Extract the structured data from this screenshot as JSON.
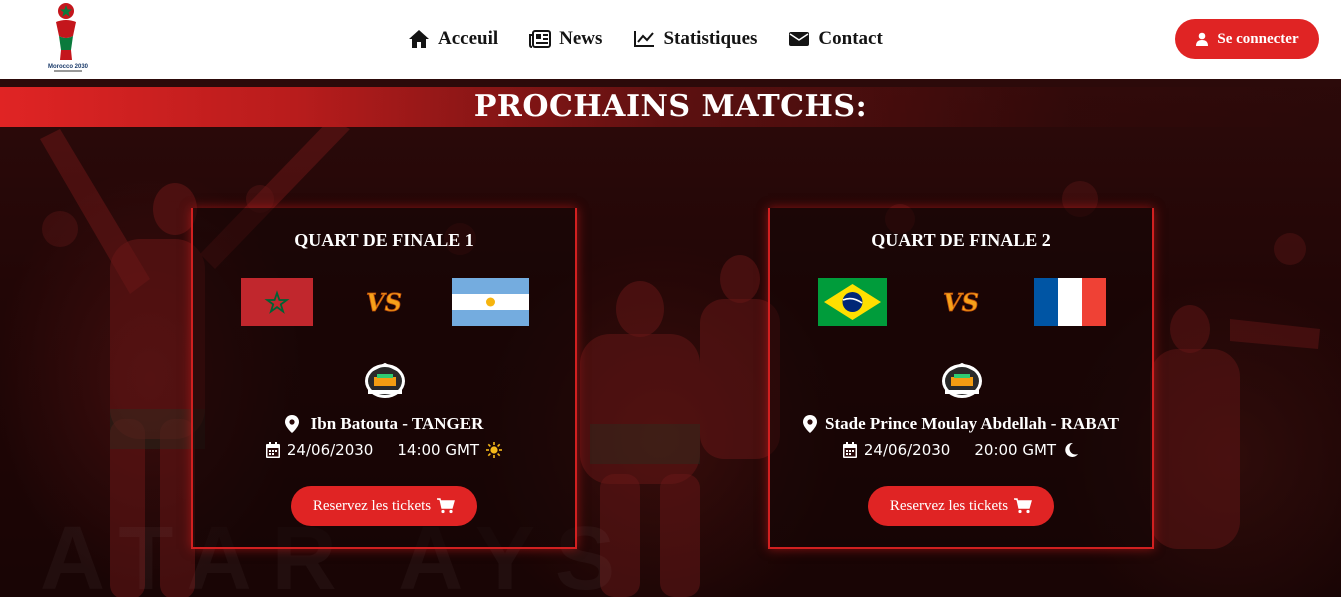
{
  "nav": {
    "items": [
      {
        "label": "Acceuil",
        "icon": "home-icon"
      },
      {
        "label": "News",
        "icon": "newspaper-icon"
      },
      {
        "label": "Statistiques",
        "icon": "chart-line-icon"
      },
      {
        "label": "Contact",
        "icon": "envelope-icon"
      }
    ],
    "login_label": "Se connecter"
  },
  "logo": {
    "text": "Morocco 2030"
  },
  "hero": {
    "title": "PROCHAINS MATCHS:"
  },
  "matches": [
    {
      "title": "QUART DE FINALE 1",
      "home_flag": "morocco-flag",
      "away_flag": "argentina-flag",
      "venue": "Ibn Batouta - TANGER",
      "date": "24/06/2030",
      "time": "14:00 GMT",
      "time_icon": "sun-icon",
      "ticket_label": "Reservez les tickets"
    },
    {
      "title": "QUART DE FINALE 2",
      "home_flag": "brazil-flag",
      "away_flag": "france-flag",
      "venue": "Stade Prince Moulay Abdellah - RABAT",
      "date": "24/06/2030",
      "time": "20:00 GMT",
      "time_icon": "moon-icon",
      "ticket_label": "Reservez les tickets"
    }
  ],
  "colors": {
    "accent": "#e02424",
    "nav_bg": "#ffffff",
    "text_dark": "#141414"
  }
}
